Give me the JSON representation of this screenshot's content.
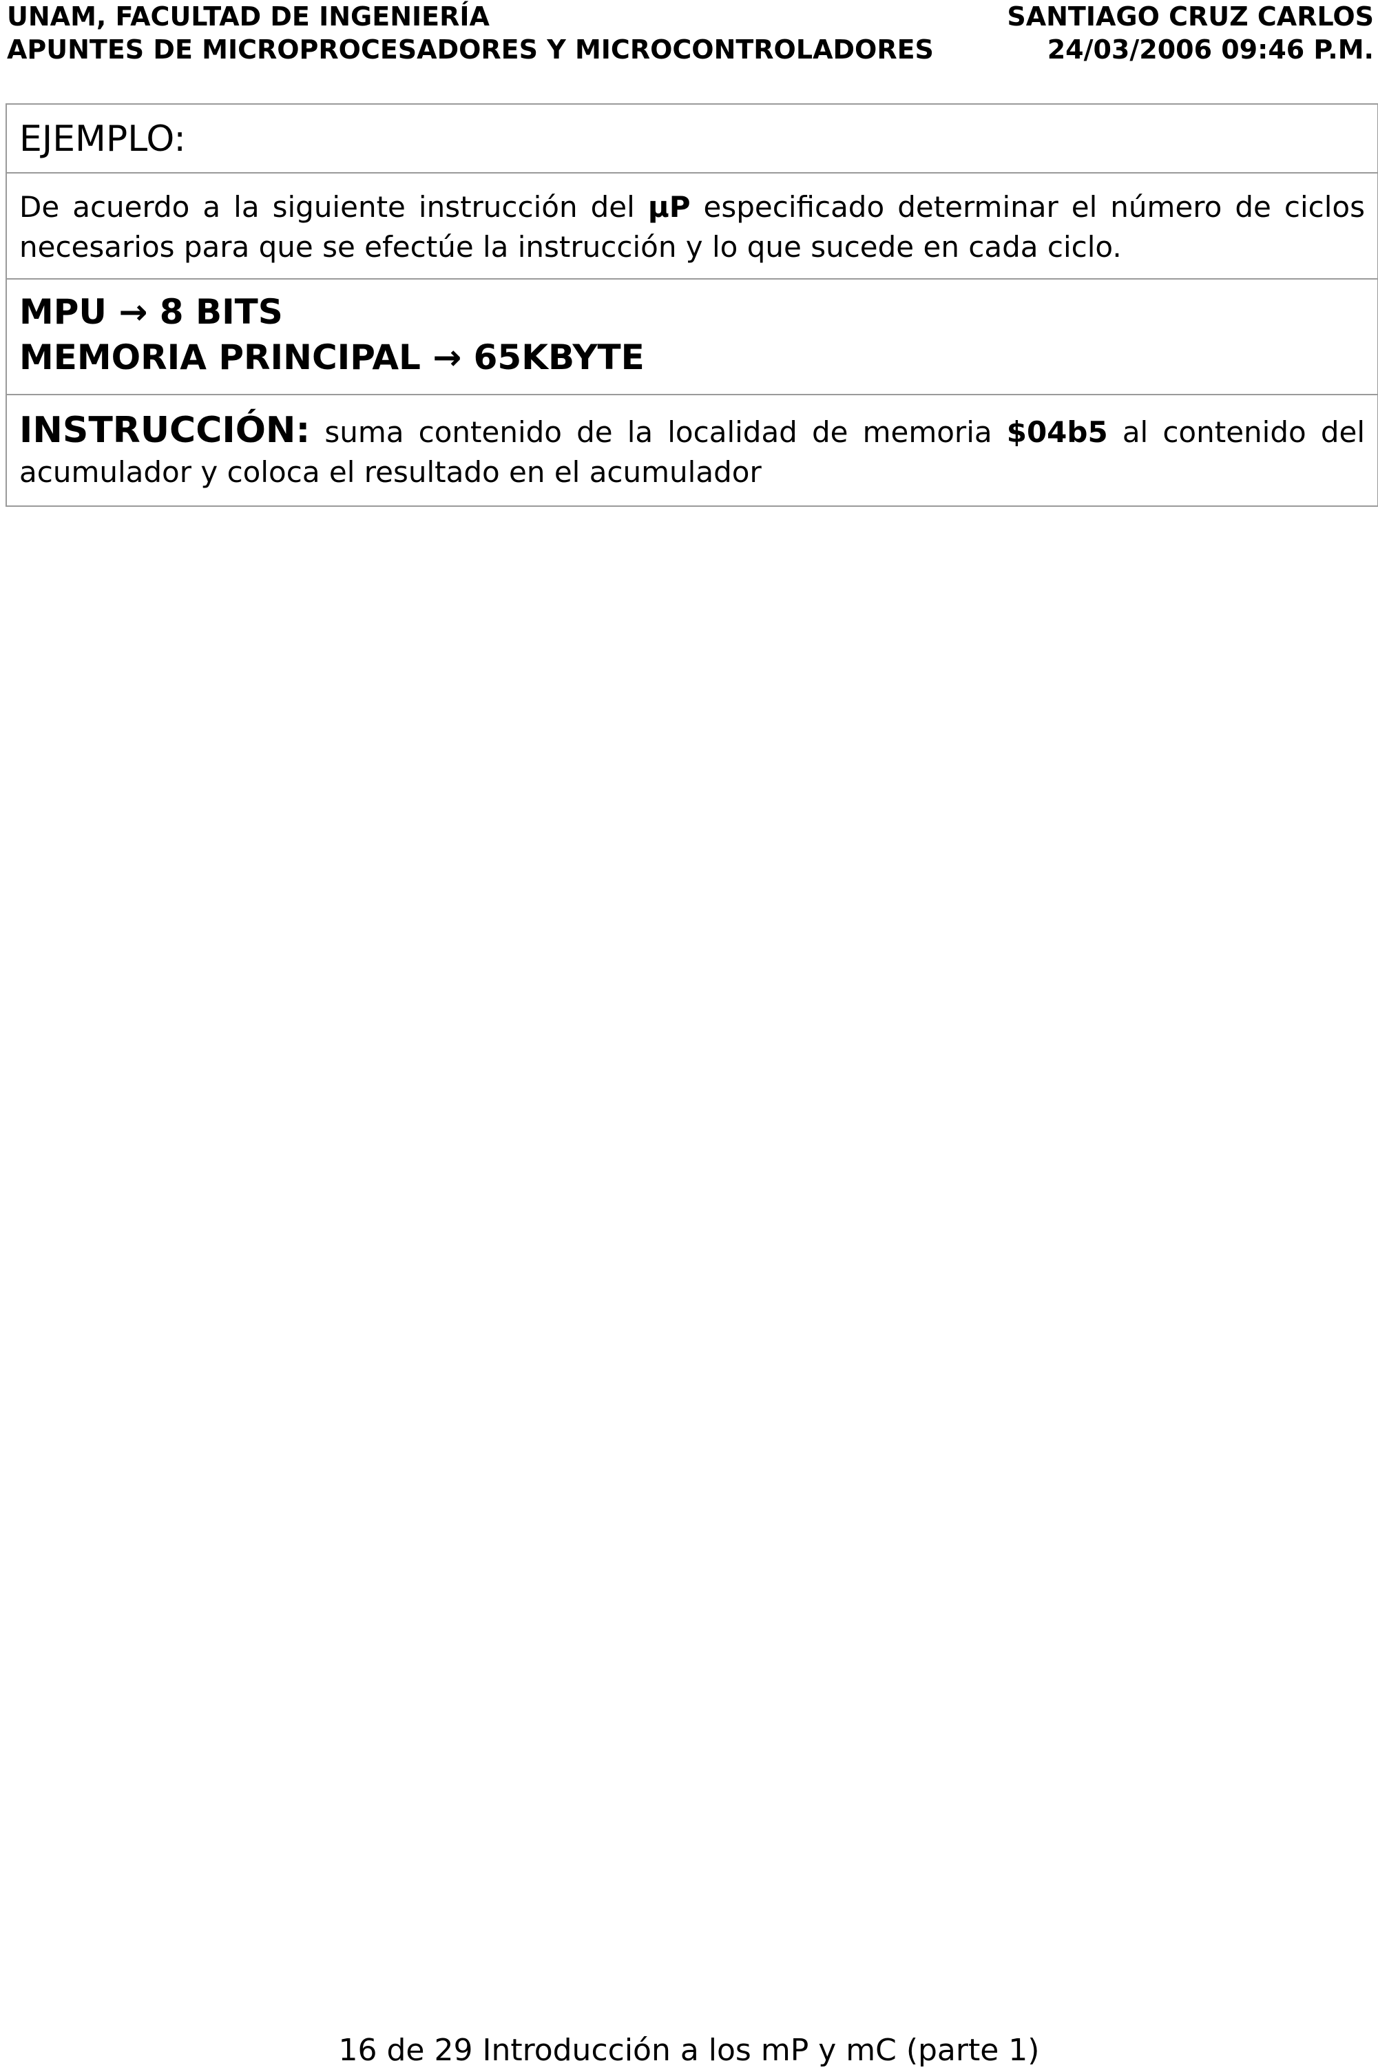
{
  "header": {
    "left_line1": "UNAM, FACULTAD DE INGENIERÍA",
    "left_line2": "APUNTES DE MICROPROCESADORES Y MICROCONTROLADORES",
    "right_line1": "SANTIAGO CRUZ CARLOS",
    "right_line2": "24/03/2006 09:46 P.M."
  },
  "example": {
    "title": "EJEMPLO:",
    "description_part1": "De acuerdo a la siguiente instrucción del ",
    "description_bold": "μP",
    "description_part2": " especificado determinar el número de ciclos necesarios para que se efectúe la instrucción y lo que sucede en cada ciclo.",
    "spec1_label": "MPU",
    "spec1_arrow": "→",
    "spec1_value": "8 BITS",
    "spec2_label": "MEMORIA PRINCIPAL",
    "spec2_arrow": "→",
    "spec2_value": "65KBYTE",
    "instruction_label": "INSTRUCCIÓN:",
    "instruction_part1": " suma contenido de la localidad de memoria ",
    "instruction_address": "$04b5",
    "instruction_part2": " al contenido del acumulador y coloca el resultado en el acumulador"
  },
  "footer": {
    "text": "16 de 29 Introducción a los mP y mC (parte 1)"
  }
}
